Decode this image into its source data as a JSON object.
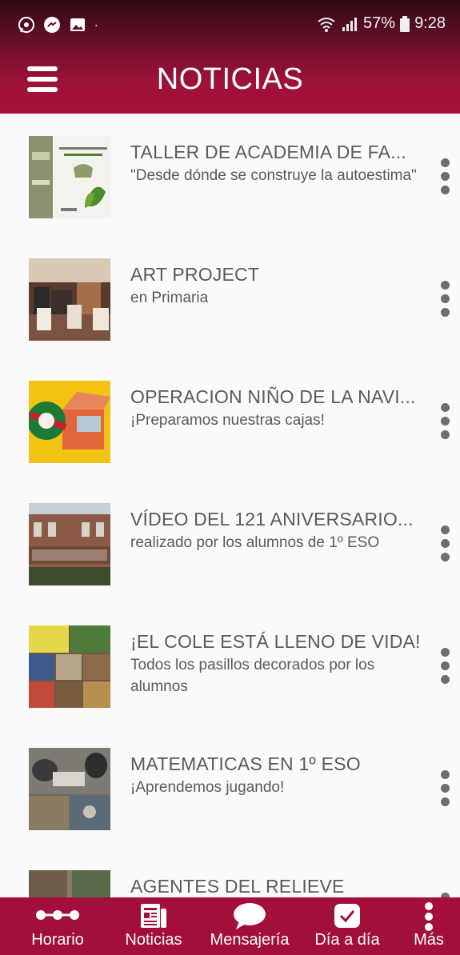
{
  "status_bar": {
    "battery": "57%",
    "time": "9:28"
  },
  "header": {
    "title": "NOTICIAS"
  },
  "news": [
    {
      "title": "TALLER DE ACADEMIA DE FA...",
      "subtitle": "\"Desde dónde se construye la autoestima\""
    },
    {
      "title": "ART PROJECT",
      "subtitle": "en Primaria"
    },
    {
      "title": "OPERACION NIÑO DE LA NAVI...",
      "subtitle": "¡Preparamos nuestras cajas!"
    },
    {
      "title": "VÍDEO DEL 121 ANIVERSARIO...",
      "subtitle": "realizado por los alumnos de 1º ESO"
    },
    {
      "title": "¡EL COLE ESTÁ LLENO DE VIDA!",
      "subtitle": "Todos los pasillos decorados por los alumnos"
    },
    {
      "title": "MATEMATICAS EN 1º ESO",
      "subtitle": "¡Aprendemos jugando!"
    },
    {
      "title": "AGENTES DEL RELIEVE",
      "subtitle": ""
    }
  ],
  "bottom_nav": [
    {
      "label": "Horario",
      "icon": "timeline-icon"
    },
    {
      "label": "Noticias",
      "icon": "newspaper-icon"
    },
    {
      "label": "Mensajería",
      "icon": "chat-bubble-icon"
    },
    {
      "label": "Día a día",
      "icon": "calendar-check-icon"
    },
    {
      "label": "Más",
      "icon": "more-vertical-icon"
    }
  ],
  "colors": {
    "brand": "#a20f3a",
    "header_dark": "#2e0812",
    "background": "#fafafa",
    "text": "#5a5a5a"
  }
}
